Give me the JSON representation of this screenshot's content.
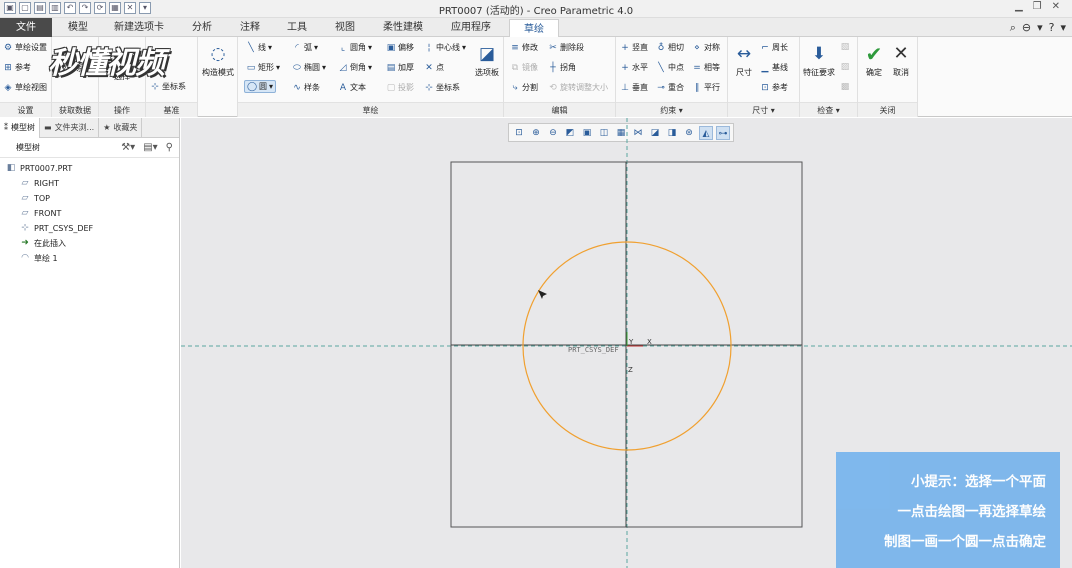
{
  "window": {
    "title": "PRT0007 (活动的) - Creo Parametric 4.0"
  },
  "tabs": [
    "文件",
    "模型",
    "新建选项卡",
    "分析",
    "注释",
    "工具",
    "视图",
    "柔性建模",
    "应用程序",
    "草绘"
  ],
  "ribbon": {
    "setup": {
      "items": [
        "草绘设置",
        "参考",
        "草绘视图"
      ],
      "footer": "设置"
    },
    "getdata": {
      "label": "文件系统",
      "footer": "获取数据"
    },
    "ops": {
      "label": "选择",
      "footer": "操作"
    },
    "datum": {
      "big": "构造模式",
      "item": "坐标系",
      "footer": "基准"
    },
    "sketch": {
      "items": [
        "线",
        "矩形",
        "圆",
        "弧",
        "椭圆",
        "样条",
        "圆角",
        "倒角",
        "文本",
        "偏移",
        "加厚",
        "投影",
        "中心线",
        "点",
        "坐标系"
      ],
      "palette": "选项板",
      "footer": "草绘"
    },
    "edit": {
      "items": [
        "修改",
        "删除段",
        "镜像",
        "拐角",
        "分割",
        "旋转调整大小"
      ],
      "footer": "编辑"
    },
    "constrain": {
      "items": [
        "竖直",
        "相切",
        "对称",
        "水平",
        "中点",
        "相等",
        "垂直",
        "重合",
        "平行"
      ],
      "footer": "约束"
    },
    "dimension": {
      "big": "尺寸",
      "items": [
        "周长",
        "基线",
        "参考"
      ],
      "footer": "尺寸"
    },
    "inspect": {
      "big": "特征要求",
      "footer": "检查"
    },
    "close": {
      "ok": "确定",
      "cancel": "取消",
      "footer": "关闭"
    }
  },
  "watermark": "秒懂视频",
  "panel": {
    "tabs": [
      "模型树",
      "文件夹浏...",
      "收藏夹"
    ],
    "tree_header": "模型树",
    "items": [
      {
        "label": "PRT0007.PRT",
        "icon": "part-icon"
      },
      {
        "label": "RIGHT",
        "icon": "datum-plane-icon"
      },
      {
        "label": "TOP",
        "icon": "datum-plane-icon"
      },
      {
        "label": "FRONT",
        "icon": "datum-plane-icon"
      },
      {
        "label": "PRT_CSYS_DEF",
        "icon": "csys-icon"
      },
      {
        "label": "在此插入",
        "icon": "insert-arrow-icon"
      },
      {
        "label": "草绘 1",
        "icon": "sketch-icon"
      }
    ]
  },
  "canvas": {
    "csys_label": "PRT_CSYS_DEF",
    "axis_x": "X",
    "axis_y": "Y",
    "axis_z": "Z",
    "circle_color": "#f0a030"
  },
  "tip": {
    "lines": [
      "小提示：选择一个平面",
      "一点击绘图一再选择草绘",
      "制图一画一个圆一点击确定"
    ]
  }
}
